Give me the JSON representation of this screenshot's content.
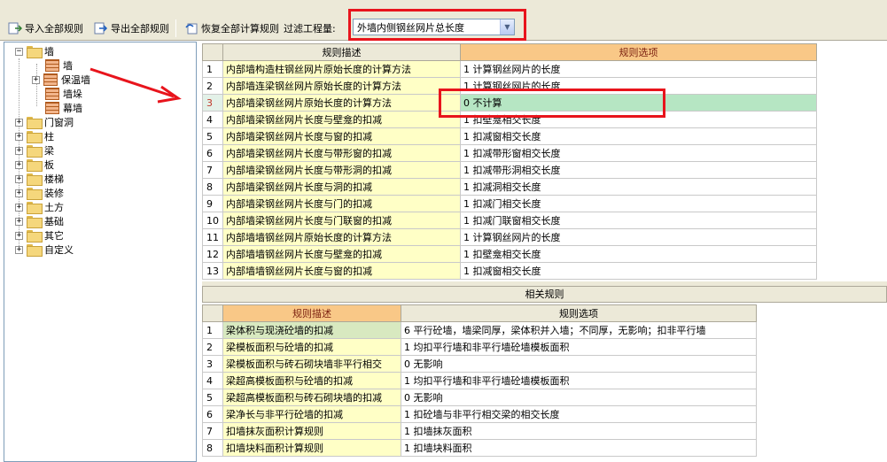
{
  "toolbar": {
    "import_label": "导入全部规则",
    "export_label": "导出全部规则",
    "restore_label": "恢复全部计算规则",
    "filter_label": "过滤工程量:",
    "filter_value": "外墙内侧钢丝网片总长度"
  },
  "tree": {
    "root": "墙",
    "children": [
      "墙",
      "保温墙",
      "墙垛",
      "幕墙"
    ],
    "others": [
      "门窗洞",
      "柱",
      "梁",
      "板",
      "楼梯",
      "装修",
      "土方",
      "基础",
      "其它",
      "自定义"
    ]
  },
  "rules_table": {
    "headers": [
      "规则描述",
      "规则选项"
    ],
    "rows": [
      {
        "no": "1",
        "desc": "内部墙构造柱钢丝网片原始长度的计算方法",
        "opt": "1  计算钢丝网片的长度"
      },
      {
        "no": "2",
        "desc": "内部墙连梁钢丝网片原始长度的计算方法",
        "opt": "1  计算钢丝网片的长度"
      },
      {
        "no": "3",
        "desc": "内部墙梁钢丝网片原始长度的计算方法",
        "opt": "0  不计算"
      },
      {
        "no": "4",
        "desc": "内部墙梁钢丝网片长度与壁龛的扣减",
        "opt": "1  扣壁龛相交长度"
      },
      {
        "no": "5",
        "desc": "内部墙梁钢丝网片长度与窗的扣减",
        "opt": "1  扣减窗相交长度"
      },
      {
        "no": "6",
        "desc": "内部墙梁钢丝网片长度与带形窗的扣减",
        "opt": "1  扣减带形窗相交长度"
      },
      {
        "no": "7",
        "desc": "内部墙梁钢丝网片长度与带形洞的扣减",
        "opt": "1  扣减带形洞相交长度"
      },
      {
        "no": "8",
        "desc": "内部墙梁钢丝网片长度与洞的扣减",
        "opt": "1  扣减洞相交长度"
      },
      {
        "no": "9",
        "desc": "内部墙梁钢丝网片长度与门的扣减",
        "opt": "1  扣减门相交长度"
      },
      {
        "no": "10",
        "desc": "内部墙梁钢丝网片长度与门联窗的扣减",
        "opt": "1  扣减门联窗相交长度"
      },
      {
        "no": "11",
        "desc": "内部墙墙钢丝网片原始长度的计算方法",
        "opt": "1  计算钢丝网片的长度"
      },
      {
        "no": "12",
        "desc": "内部墙墙钢丝网片长度与壁龛的扣减",
        "opt": "1  扣壁龛相交长度"
      },
      {
        "no": "13",
        "desc": "内部墙墙钢丝网片长度与窗的扣减",
        "opt": "1  扣减窗相交长度"
      }
    ]
  },
  "related": {
    "title": "相关规则",
    "headers": [
      "规则描述",
      "规则选项"
    ],
    "rows": [
      {
        "no": "1",
        "desc": "梁体积与现浇砼墙的扣减",
        "opt": "6  平行砼墙，墙梁同厚，梁体积并入墙；不同厚，无影响；扣非平行墙"
      },
      {
        "no": "2",
        "desc": "梁模板面积与砼墙的扣减",
        "opt": "1  均扣平行墙和非平行墙砼墙模板面积"
      },
      {
        "no": "3",
        "desc": "梁模板面积与砖石砌块墙非平行相交",
        "opt": "0    无影响"
      },
      {
        "no": "4",
        "desc": "梁超高模板面积与砼墙的扣减",
        "opt": "1  均扣平行墙和非平行墙砼墙模板面积"
      },
      {
        "no": "5",
        "desc": "梁超高模板面积与砖石砌块墙的扣减",
        "opt": "0    无影响"
      },
      {
        "no": "6",
        "desc": "梁净长与非平行砼墙的扣减",
        "opt": "1  扣砼墙与非平行相交梁的相交长度"
      },
      {
        "no": "7",
        "desc": "扣墙抹灰面积计算规则",
        "opt": "1  扣墙抹灰面积"
      },
      {
        "no": "8",
        "desc": "扣墙块料面积计算规则",
        "opt": "1  扣墙块料面积"
      }
    ]
  },
  "colors": {
    "highlight_box": "#E8141C",
    "selected_option": "#B6E6C3",
    "desc_bg": "#FFFFC6",
    "header_highlight": "#F9C887"
  }
}
